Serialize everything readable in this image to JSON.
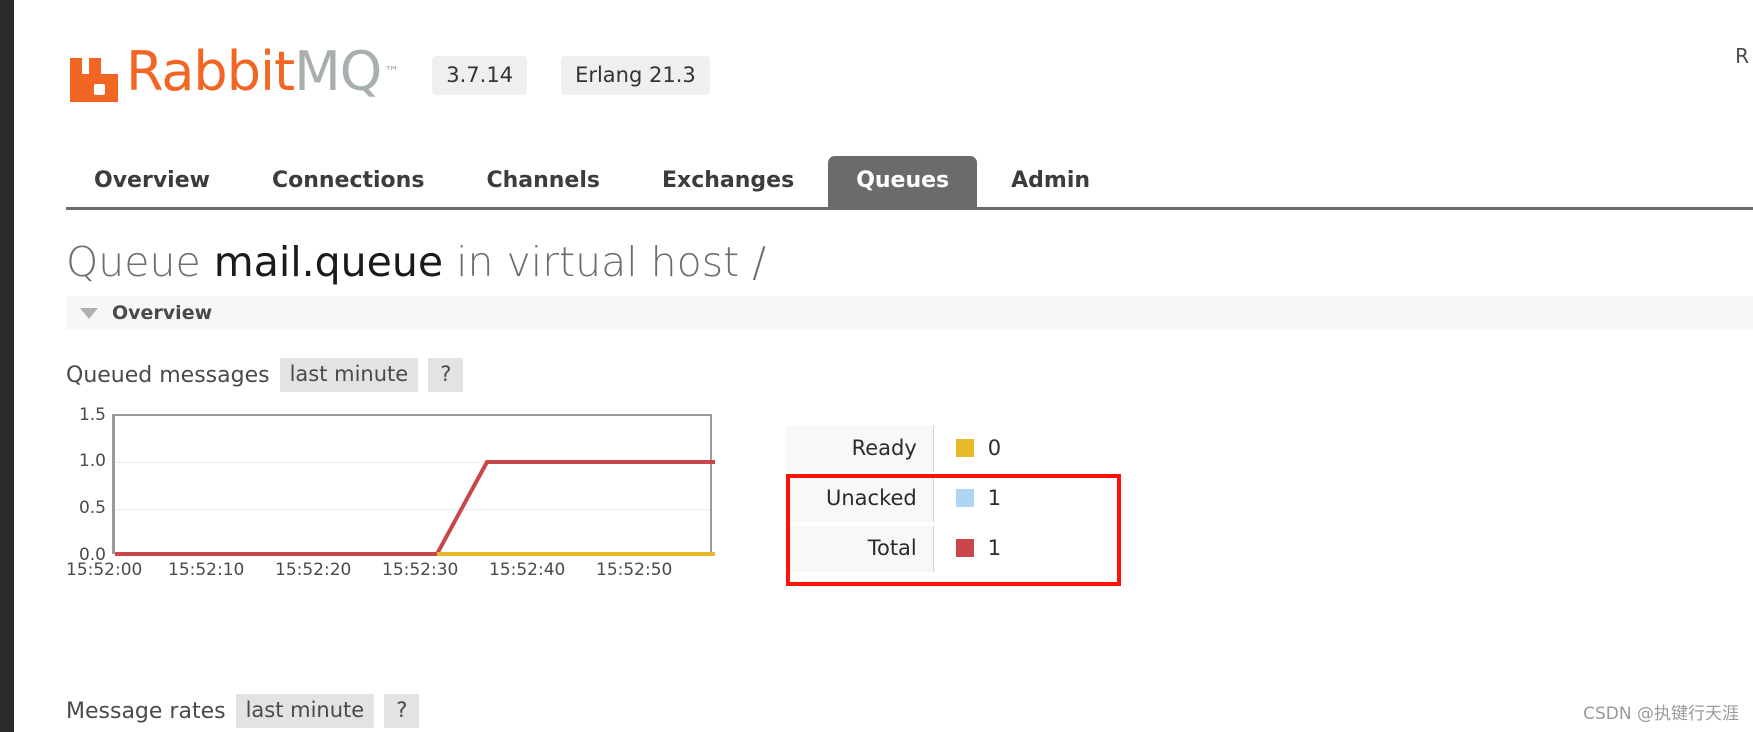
{
  "brand": {
    "name_primary": "Rabbit",
    "name_secondary": "MQ",
    "trademark": "™",
    "logo_icon": "rabbit-ears-icon",
    "color_primary": "#f26522",
    "color_secondary": "#a8b0ad"
  },
  "header": {
    "version_badge": "3.7.14",
    "erlang_badge": "Erlang 21.3",
    "edge_text": "R"
  },
  "nav": {
    "items": [
      {
        "label": "Overview",
        "active": false
      },
      {
        "label": "Connections",
        "active": false
      },
      {
        "label": "Channels",
        "active": false
      },
      {
        "label": "Exchanges",
        "active": false
      },
      {
        "label": "Queues",
        "active": true
      },
      {
        "label": "Admin",
        "active": false
      }
    ]
  },
  "page_title": {
    "prefix": "Queue",
    "queue_name": "mail.queue",
    "suffix": "in virtual host /"
  },
  "overview_section": {
    "caret_icon": "caret-down-icon",
    "title": "Overview"
  },
  "queued_messages": {
    "label": "Queued messages",
    "period_chip": "last minute",
    "help_chip": "?"
  },
  "message_rates": {
    "label": "Message rates",
    "period_chip": "last minute",
    "help_chip": "?"
  },
  "stats": {
    "rows": [
      {
        "label": "Ready",
        "value": "0",
        "color": "#e8b92b",
        "highlighted": false
      },
      {
        "label": "Unacked",
        "value": "1",
        "color": "#aed6f4",
        "highlighted": true
      },
      {
        "label": "Total",
        "value": "1",
        "color": "#c9464b",
        "highlighted": true
      }
    ],
    "annotation_color": "#fb1405"
  },
  "watermark": "CSDN @执键行天涯",
  "chart_data": {
    "type": "line",
    "title": "Queued messages",
    "subtitle": "last minute",
    "xlabel": "",
    "ylabel": "",
    "ylim": [
      0,
      1.5
    ],
    "yticks": [
      "1.5",
      "1.0",
      "0.5",
      "0.0"
    ],
    "ytick_values": [
      1.5,
      1.0,
      0.5,
      0.0
    ],
    "xticks": [
      "15:52:00",
      "15:52:10",
      "15:52:20",
      "15:52:30",
      "15:52:40",
      "15:52:50"
    ],
    "grid": true,
    "legend_position": "right",
    "series": [
      {
        "name": "Total",
        "color": "#c9464b",
        "x": [
          "15:52:00",
          "15:52:10",
          "15:52:20",
          "15:52:30",
          "15:52:33",
          "15:52:40",
          "15:52:50",
          "15:52:58"
        ],
        "values": [
          0,
          0,
          0,
          0,
          1,
          1,
          1,
          1
        ]
      },
      {
        "name": "Ready",
        "color": "#e8b92b",
        "x": [
          "15:52:00",
          "15:52:10",
          "15:52:20",
          "15:52:30",
          "15:52:33",
          "15:52:40",
          "15:52:50",
          "15:52:58"
        ],
        "values": [
          0,
          0,
          0,
          0,
          0,
          0,
          0,
          0
        ]
      },
      {
        "name": "Unacked",
        "color": "#aed6f4",
        "x": [
          "15:52:00",
          "15:52:10",
          "15:52:20",
          "15:52:30",
          "15:52:33",
          "15:52:40",
          "15:52:50",
          "15:52:58"
        ],
        "values": [
          0,
          0,
          0,
          0,
          1,
          1,
          1,
          1
        ]
      }
    ]
  }
}
